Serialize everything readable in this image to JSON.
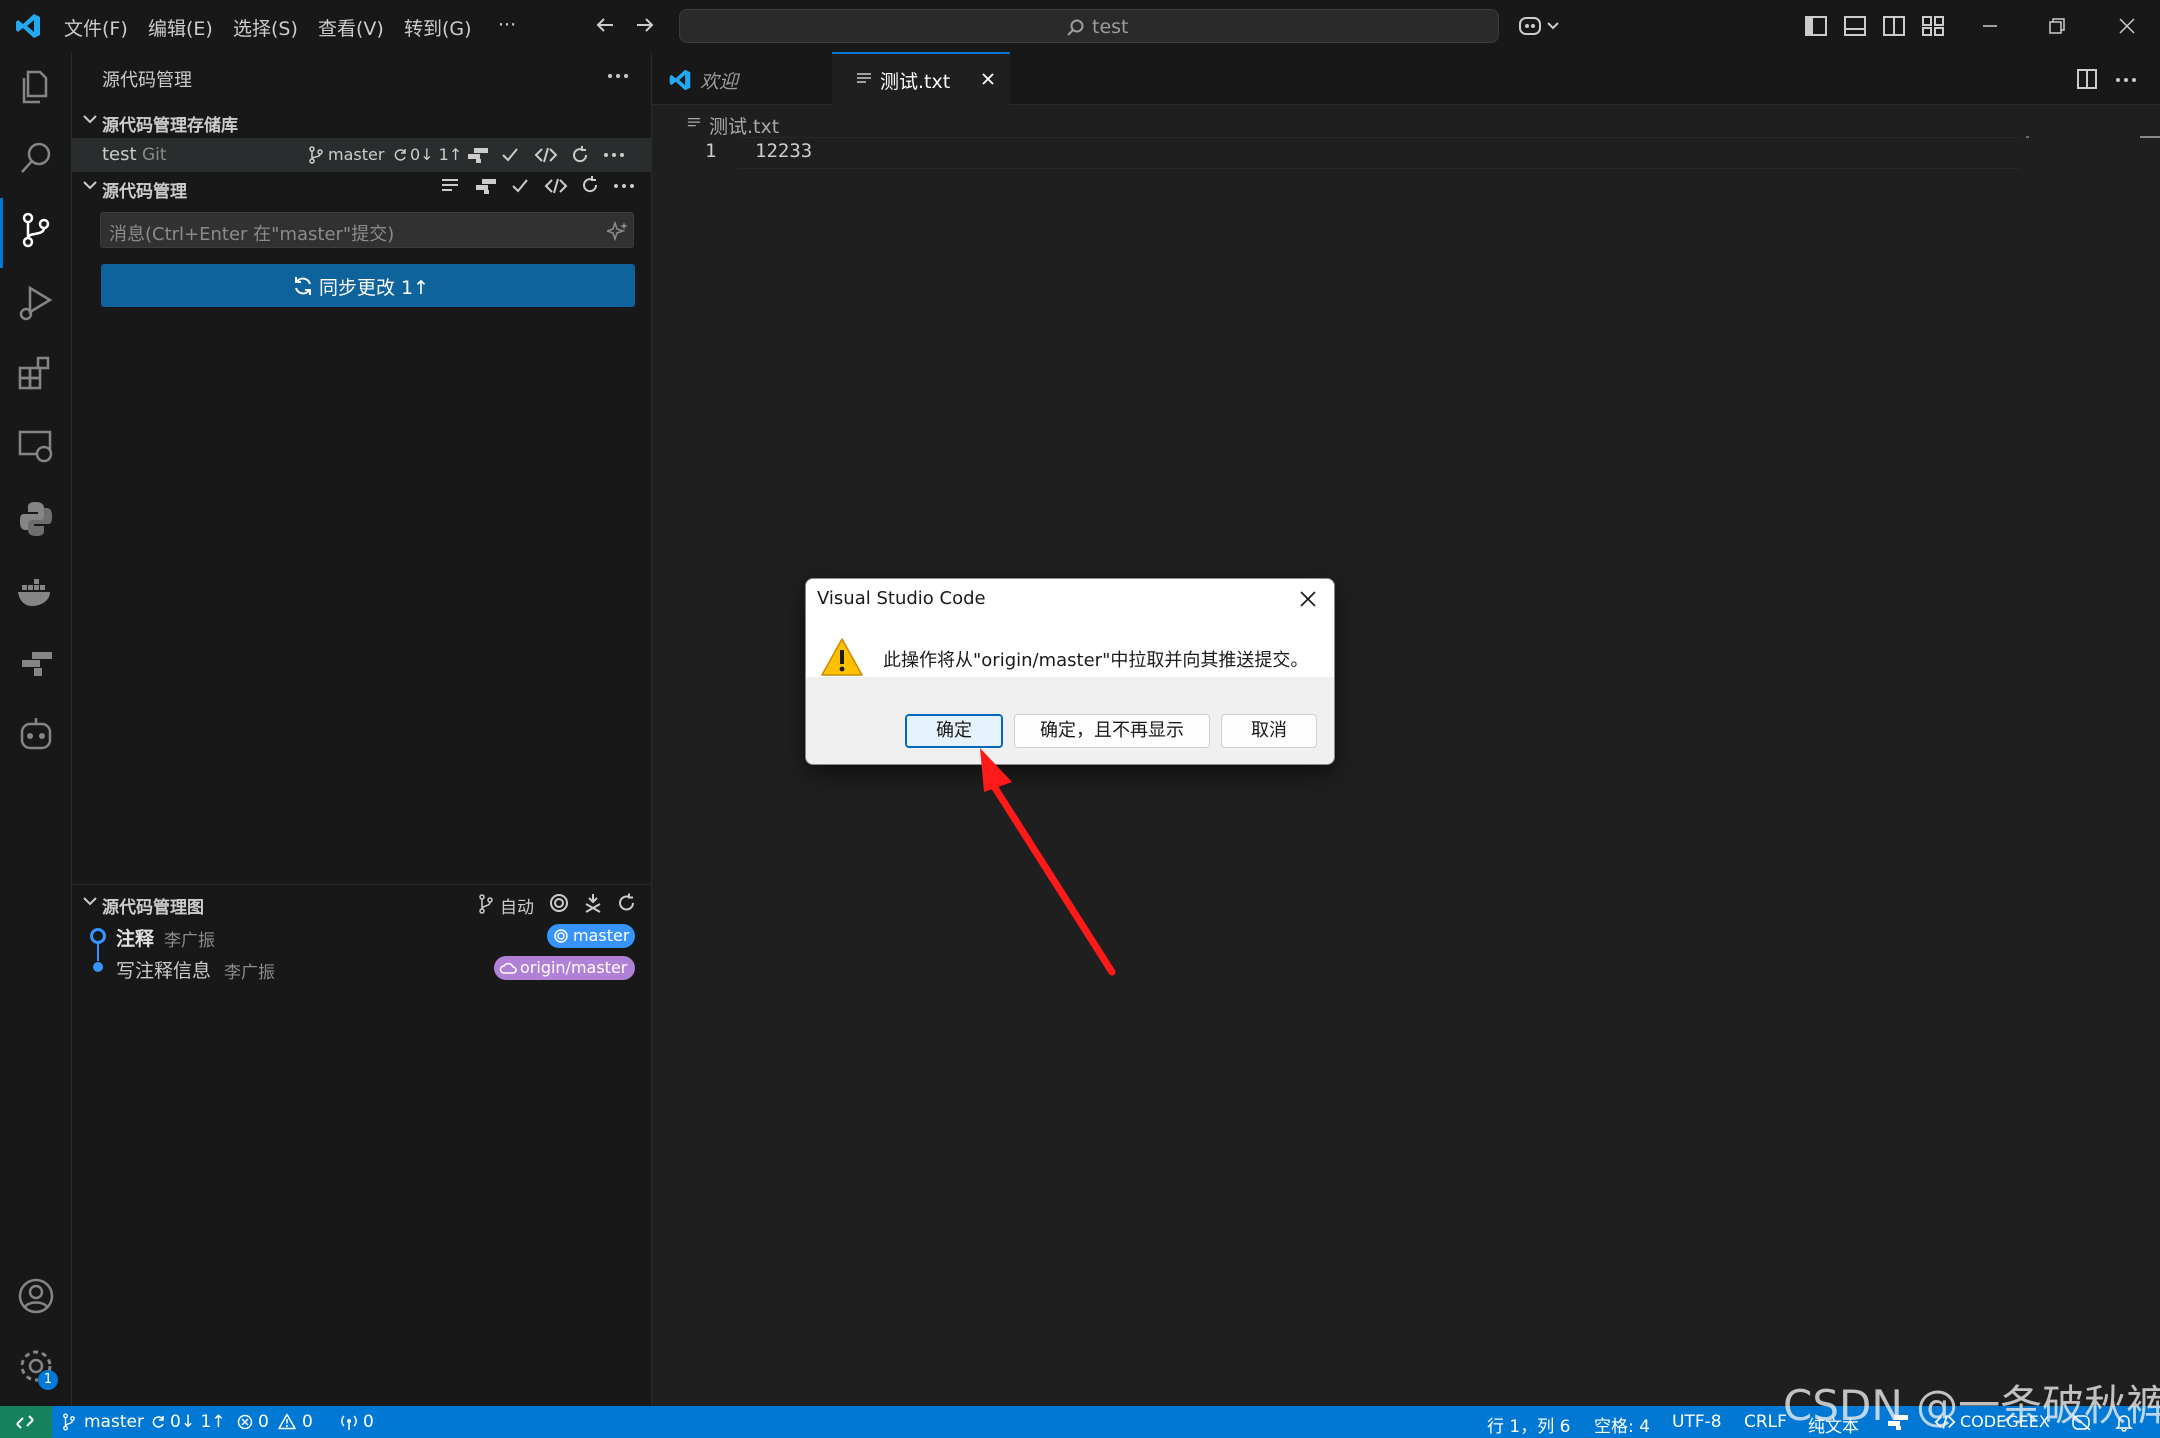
{
  "titlebar": {
    "menus": [
      "文件(F)",
      "编辑(E)",
      "选择(S)",
      "查看(V)",
      "转到(G)",
      "···"
    ],
    "search_text": "test"
  },
  "sidebar": {
    "title": "源代码管理",
    "repos_section": "源代码管理存储库",
    "repo": {
      "name": "test",
      "type": "Git",
      "branch": "master",
      "sync": "0↓ 1↑"
    },
    "scm_section": "源代码管理",
    "commit_placeholder": "消息(Ctrl+Enter 在\"master\"提交)",
    "sync_button": "同步更改 1↑",
    "graph_section": "源代码管理图",
    "graph_mode": "自动",
    "commits": [
      {
        "message": "注释",
        "author": "李广振",
        "badge": "master"
      },
      {
        "message": "写注释信息",
        "author": "李广振",
        "badge": "origin/master"
      }
    ]
  },
  "editor": {
    "tabs": [
      {
        "label": "欢迎"
      },
      {
        "label": "测试.txt"
      }
    ],
    "breadcrumb": "测试.txt",
    "lines": [
      {
        "number": "1",
        "text": "12233"
      }
    ]
  },
  "dialog": {
    "title": "Visual Studio Code",
    "message": "此操作将从\"origin/master\"中拉取并向其推送提交。",
    "ok_button": "确定",
    "ok_dont_show_button": "确定，且不再显示",
    "cancel_button": "取消"
  },
  "statusbar": {
    "branch": "master",
    "sync": "0↓ 1↑",
    "errors": "0",
    "warnings": "0",
    "ports": "0",
    "position": "行 1，列 6",
    "spaces": "空格: 4",
    "encoding": "UTF-8",
    "eol": "CRLF",
    "language": "纯文本",
    "codegeex": "CODEGEEX"
  },
  "settings_badge": "1",
  "watermark": "CSDN @一条破秋裤",
  "colors": {
    "accent": "#0078d4",
    "sync_button": "#0e639c",
    "master_badge": "#3794ff",
    "origin_badge": "#b180d7",
    "annotation_arrow": "#ff1a1a"
  }
}
